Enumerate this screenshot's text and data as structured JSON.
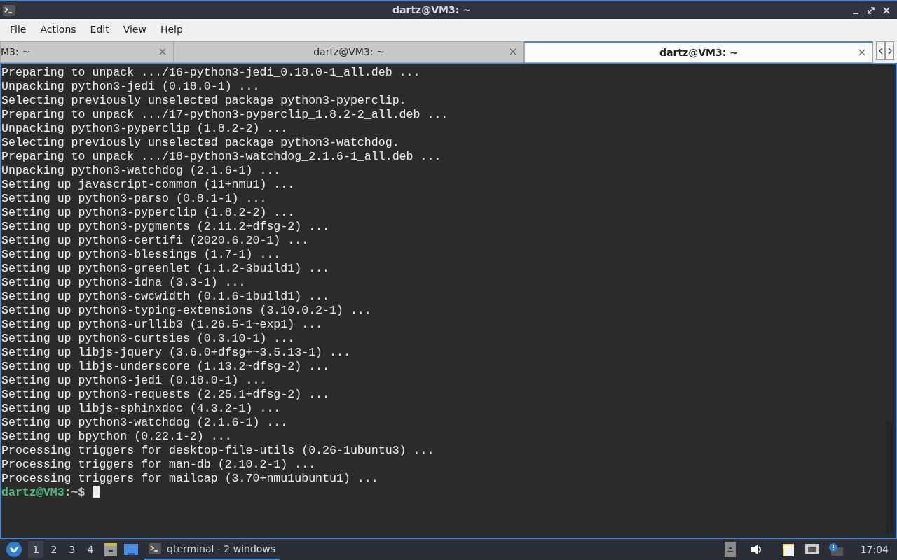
{
  "window": {
    "title": "dartz@VM3: ~"
  },
  "menu": [
    "File",
    "Actions",
    "Edit",
    "View",
    "Help"
  ],
  "tabs": [
    {
      "label": "M3: ~",
      "selected": false
    },
    {
      "label": "dartz@VM3: ~",
      "selected": false
    },
    {
      "label": "dartz@VM3: ~",
      "selected": true
    }
  ],
  "terminal": {
    "lines": [
      "Preparing to unpack .../16-python3-jedi_0.18.0-1_all.deb ...",
      "Unpacking python3-jedi (0.18.0-1) ...",
      "Selecting previously unselected package python3-pyperclip.",
      "Preparing to unpack .../17-python3-pyperclip_1.8.2-2_all.deb ...",
      "Unpacking python3-pyperclip (1.8.2-2) ...",
      "Selecting previously unselected package python3-watchdog.",
      "Preparing to unpack .../18-python3-watchdog_2.1.6-1_all.deb ...",
      "Unpacking python3-watchdog (2.1.6-1) ...",
      "Setting up javascript-common (11+nmu1) ...",
      "Setting up python3-parso (0.8.1-1) ...",
      "Setting up python3-pyperclip (1.8.2-2) ...",
      "Setting up python3-pygments (2.11.2+dfsg-2) ...",
      "Setting up python3-certifi (2020.6.20-1) ...",
      "Setting up python3-blessings (1.7-1) ...",
      "Setting up python3-greenlet (1.1.2-3build1) ...",
      "Setting up python3-idna (3.3-1) ...",
      "Setting up python3-cwcwidth (0.1.6-1build1) ...",
      "Setting up python3-typing-extensions (3.10.0.2-1) ...",
      "Setting up python3-urllib3 (1.26.5-1~exp1) ...",
      "Setting up python3-curtsies (0.3.10-1) ...",
      "Setting up libjs-jquery (3.6.0+dfsg+~3.5.13-1) ...",
      "Setting up libjs-underscore (1.13.2~dfsg-2) ...",
      "Setting up python3-jedi (0.18.0-1) ...",
      "Setting up python3-requests (2.25.1+dfsg-2) ...",
      "Setting up libjs-sphinxdoc (4.3.2-1) ...",
      "Setting up python3-watchdog (2.1.6-1) ...",
      "Setting up bpython (0.22.1-2) ...",
      "Processing triggers for desktop-file-utils (0.26-1ubuntu3) ...",
      "Processing triggers for man-db (2.10.2-1) ...",
      "Processing triggers for mailcap (3.70+nmu1ubuntu1) ..."
    ],
    "prompt_user": "dartz@VM3",
    "prompt_path": ":~$"
  },
  "taskbar": {
    "desktops": [
      {
        "label": "1",
        "selected": true
      },
      {
        "label": "2",
        "selected": false
      },
      {
        "label": "3",
        "selected": false
      },
      {
        "label": "4",
        "selected": false
      }
    ],
    "task": "qterminal - 2 windows",
    "clock": "17:04"
  }
}
